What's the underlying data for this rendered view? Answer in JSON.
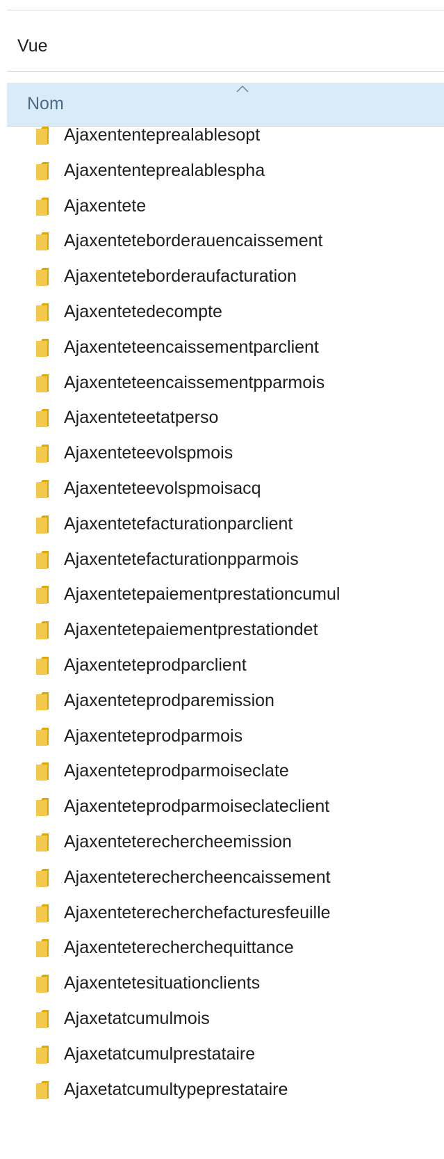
{
  "view_label": "Vue",
  "column_header": {
    "label": "Nom",
    "sort": "ascending"
  },
  "files": [
    "Ajaxententeprealablesopt",
    "Ajaxententeprealablespha",
    "Ajaxentete",
    "Ajaxenteteborderauencaissement",
    "Ajaxenteteborderaufacturation",
    "Ajaxentetedecompte",
    "Ajaxenteteencaissementparclient",
    "Ajaxenteteencaissementpparmois",
    "Ajaxenteteetatperso",
    "Ajaxenteteevolspmois",
    "Ajaxenteteevolspmoisacq",
    "Ajaxentetefacturationparclient",
    "Ajaxentetefacturationpparmois",
    "Ajaxentetepaiementprestationcumul",
    "Ajaxentetepaiementprestationdet",
    "Ajaxenteteprodparclient",
    "Ajaxenteteprodparemission",
    "Ajaxenteteprodparmois",
    "Ajaxenteteprodparmoiseclate",
    "Ajaxenteteprodparmoiseclateclient",
    "Ajaxenteterechercheemission",
    "Ajaxenteterechercheencaissement",
    "Ajaxenteterecherchefacturesfeuille",
    "Ajaxenteterecherchequittance",
    "Ajaxentetesituationclients",
    "Ajaxetatcumulmois",
    "Ajaxetatcumulprestataire",
    "Ajaxetatcumultypeprestataire"
  ],
  "colors": {
    "folder": "#f2c94c",
    "folder_dark": "#e0a800",
    "header_bg": "#d9ebf8",
    "header_text": "#4a6b88"
  },
  "icons": {
    "folder": "folder-icon",
    "sort": "sort-ascending-icon"
  }
}
